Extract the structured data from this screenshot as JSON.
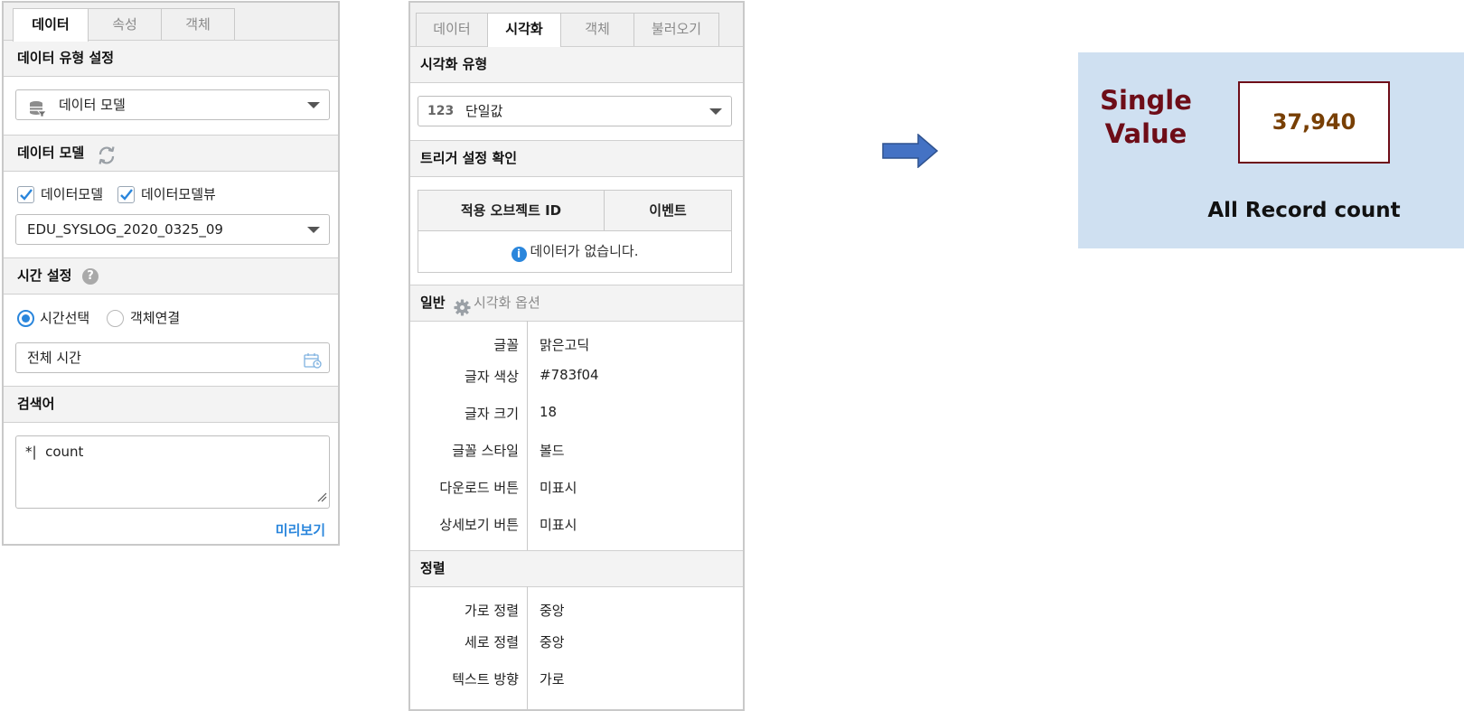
{
  "left_panel": {
    "tabs": [
      "데이터",
      "속성",
      "객체"
    ],
    "data_type_section": {
      "title": "데이터 유형 설정",
      "selected": "데이터 모델",
      "icon": "database-icon"
    },
    "data_model_section": {
      "title": "데이터 모델",
      "refresh_icon": "refresh-icon",
      "checkboxes": [
        {
          "label": "데이터모델",
          "checked": true
        },
        {
          "label": "데이터모델뷰",
          "checked": true
        }
      ],
      "selected_model": "EDU_SYSLOG_2020_0325_09"
    },
    "time_section": {
      "title": "시간 설정",
      "help_icon": "help-icon",
      "radios": [
        {
          "label": "시간선택",
          "selected": true
        },
        {
          "label": "객체연결",
          "selected": false
        }
      ],
      "time_value": "전체 시간",
      "calendar_icon": "calendar-icon"
    },
    "search_section": {
      "title": "검색어",
      "query": "*|  count",
      "preview_label": "미리보기"
    }
  },
  "middle_panel": {
    "tabs": [
      "데이터",
      "시각화",
      "객체",
      "불러오기"
    ],
    "viz_type_section": {
      "title": "시각화 유형",
      "prefix": "123",
      "selected": "단일값"
    },
    "trigger_section": {
      "title": "트리거 설정 확인",
      "columns": [
        "적용 오브젝트 ID",
        "이벤트"
      ],
      "empty_message": "데이터가 없습니다.",
      "info_icon": "info-icon"
    },
    "general_section": {
      "title": "일반",
      "options_label": "시각화 옵션",
      "gear_icon": "gear-icon",
      "properties": [
        {
          "key": "글꼴",
          "value": "맑은고딕"
        },
        {
          "key": "글자 색상",
          "value": "#783f04"
        },
        {
          "key": "글자 크기",
          "value": "18"
        },
        {
          "key": "글꼴 스타일",
          "value": "볼드"
        },
        {
          "key": "다운로드 버튼",
          "value": "미표시"
        },
        {
          "key": "상세보기 버튼",
          "value": "미표시"
        }
      ]
    },
    "align_section": {
      "title": "정렬",
      "properties": [
        {
          "key": "가로 정렬",
          "value": "중앙"
        },
        {
          "key": "세로 정렬",
          "value": "중앙"
        },
        {
          "key": "텍스트 방향",
          "value": "가로"
        }
      ]
    }
  },
  "arrow_icon": "right-arrow-icon",
  "result_card": {
    "label_line1": "Single",
    "label_line2": "Value",
    "value": "37,940",
    "caption": "All Record count",
    "colors": {
      "background": "#cfe0f1",
      "label": "#6e0d18",
      "value": "#783f04"
    }
  }
}
